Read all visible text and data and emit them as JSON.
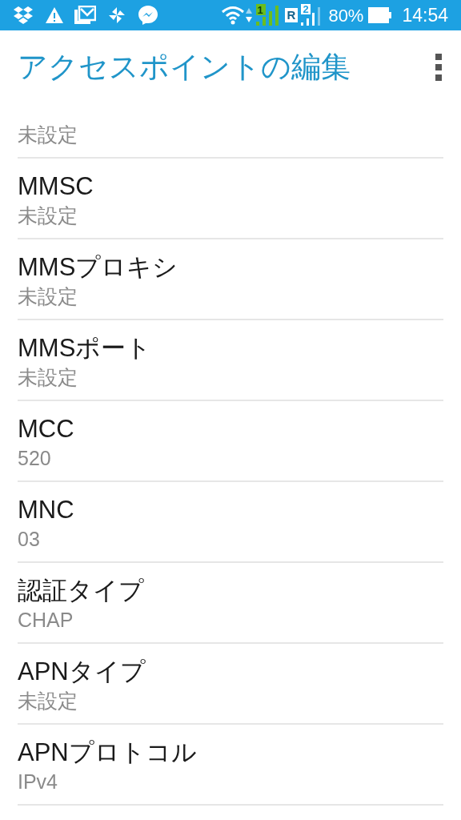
{
  "status_bar": {
    "roaming": "R",
    "sim1": "1",
    "sim2": "2",
    "battery": "80%",
    "time": "14:54"
  },
  "app_bar": {
    "title": "アクセスポイントの編集"
  },
  "settings": [
    {
      "value": "未設定"
    },
    {
      "title": "MMSC",
      "value": "未設定"
    },
    {
      "title": "MMSプロキシ",
      "value": "未設定"
    },
    {
      "title": "MMSポート",
      "value": "未設定"
    },
    {
      "title": "MCC",
      "value": "520"
    },
    {
      "title": "MNC",
      "value": "03"
    },
    {
      "title": "認証タイプ",
      "value": "CHAP"
    },
    {
      "title": "APNタイプ",
      "value": "未設定"
    },
    {
      "title": "APNプロトコル",
      "value": "IPv4"
    }
  ]
}
